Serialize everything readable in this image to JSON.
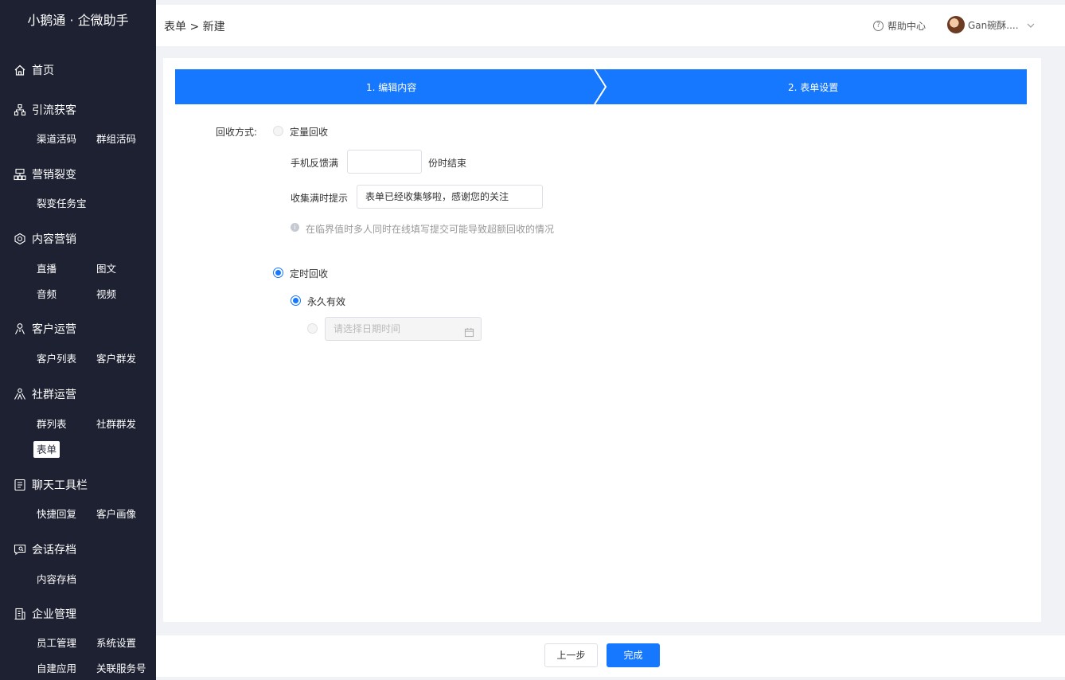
{
  "brand": "小鹅通 · 企微助手",
  "sidebar": {
    "groups": [
      {
        "label": "首页",
        "icon": "home-icon",
        "items": []
      },
      {
        "label": "引流获客",
        "icon": "org-tree-icon",
        "items": [
          "渠道活码",
          "群组活码"
        ]
      },
      {
        "label": "营销裂变",
        "icon": "hierarchy-icon",
        "items": [
          "裂变任务宝"
        ]
      },
      {
        "label": "内容营销",
        "icon": "content-icon",
        "items": [
          "直播",
          "图文",
          "音频",
          "视频"
        ]
      },
      {
        "label": "客户运营",
        "icon": "person-icon",
        "items": [
          "客户列表",
          "客户群发"
        ]
      },
      {
        "label": "社群运营",
        "icon": "group-icon",
        "items": [
          "群列表",
          "社群群发",
          "表单"
        ]
      },
      {
        "label": "聊天工具栏",
        "icon": "toolbar-icon",
        "items": [
          "快捷回复",
          "客户画像"
        ]
      },
      {
        "label": "会话存档",
        "icon": "chat-archive-icon",
        "items": [
          "内容存档"
        ]
      },
      {
        "label": "企业管理",
        "icon": "building-icon",
        "items": [
          "员工管理",
          "系统设置",
          "自建应用",
          "关联服务号"
        ]
      }
    ],
    "active_item": "表单"
  },
  "header": {
    "breadcrumb": "表单 > 新建",
    "help": "帮助中心",
    "user": "Gan碗酥...."
  },
  "steps": [
    "1. 编辑内容",
    "2. 表单设置"
  ],
  "form": {
    "recycle_label": "回收方式:",
    "quantity_option": "定量回收",
    "feedback_prefix": "手机反馈满",
    "feedback_value": "",
    "feedback_suffix": "份时结束",
    "full_tip_label": "收集满时提示",
    "full_tip_value": "表单已经收集够啦，感谢您的关注",
    "warning": "在临界值时多人同时在线填写提交可能导致超额回收的情况",
    "timed_option": "定时回收",
    "forever_option": "永久有效",
    "date_placeholder": "请选择日期时间"
  },
  "footer": {
    "prev": "上一步",
    "finish": "完成"
  },
  "colors": {
    "sidebar_bg": "#1e2132",
    "primary": "#1677ff"
  }
}
